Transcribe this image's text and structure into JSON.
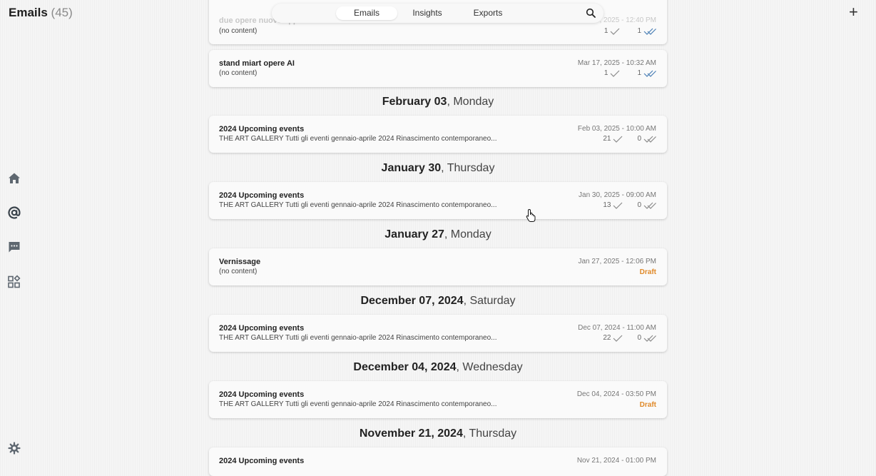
{
  "header": {
    "title": "Emails",
    "count": "(45)",
    "add_label": "+"
  },
  "nav": {
    "tabs": [
      "Emails",
      "Insights",
      "Exports"
    ],
    "active": "Emails"
  },
  "sidebar": {
    "icons": [
      "home-icon",
      "at-icon",
      "chat-icon",
      "apps-icon",
      "settings-icon"
    ]
  },
  "list": {
    "partial_top": {
      "subject": "due opere nuove appena arrivate",
      "preview": "(no content)",
      "date": "Mar 17, 2025 - 12:40 PM",
      "sent": "1",
      "read": "1"
    },
    "card_mar17": {
      "subject": "stand miart opere AI",
      "preview": "(no content)",
      "date": "Mar 17, 2025 - 10:32 AM",
      "sent": "1",
      "read": "1"
    },
    "groups": [
      {
        "date": "February 03",
        "dow": ", Monday",
        "email": {
          "subject": "2024 Upcoming events",
          "preview": "THE ART GALLERY Tutti gli eventi gennaio-aprile 2024 Rinascimento contemporaneo...",
          "date": "Feb 03, 2025 - 10:00 AM",
          "sent": "21",
          "read": "0"
        }
      },
      {
        "date": "January 30",
        "dow": ", Thursday",
        "email": {
          "subject": "2024 Upcoming events",
          "preview": "THE ART GALLERY Tutti gli eventi gennaio-aprile 2024 Rinascimento contemporaneo...",
          "date": "Jan 30, 2025 - 09:00 AM",
          "sent": "13",
          "read": "0"
        }
      },
      {
        "date": "January 27",
        "dow": ", Monday",
        "email": {
          "subject": "Vernissage",
          "preview": "(no content)",
          "date": "Jan 27, 2025 - 12:06 PM",
          "status": "Draft"
        }
      },
      {
        "date": "December 07, 2024",
        "dow": ", Saturday",
        "email": {
          "subject": "2024 Upcoming events",
          "preview": "THE ART GALLERY Tutti gli eventi gennaio-aprile 2024 Rinascimento contemporaneo...",
          "date": "Dec 07, 2024 - 11:00 AM",
          "sent": "22",
          "read": "0"
        }
      },
      {
        "date": "December 04, 2024",
        "dow": ", Wednesday",
        "email": {
          "subject": "2024 Upcoming events",
          "preview": "THE ART GALLERY Tutti gli eventi gennaio-aprile 2024 Rinascimento contemporaneo...",
          "date": "Dec 04, 2024 - 03:50 PM",
          "status": "Draft"
        }
      },
      {
        "date": "November 21, 2024",
        "dow": ", Thursday",
        "email": {
          "subject": "2024 Upcoming events",
          "date": "Nov 21, 2024 - 01:00 PM"
        }
      }
    ]
  },
  "colors": {
    "accent": "#4a7fb5",
    "draft": "#e08a2a",
    "background": "#f5f5f5"
  }
}
